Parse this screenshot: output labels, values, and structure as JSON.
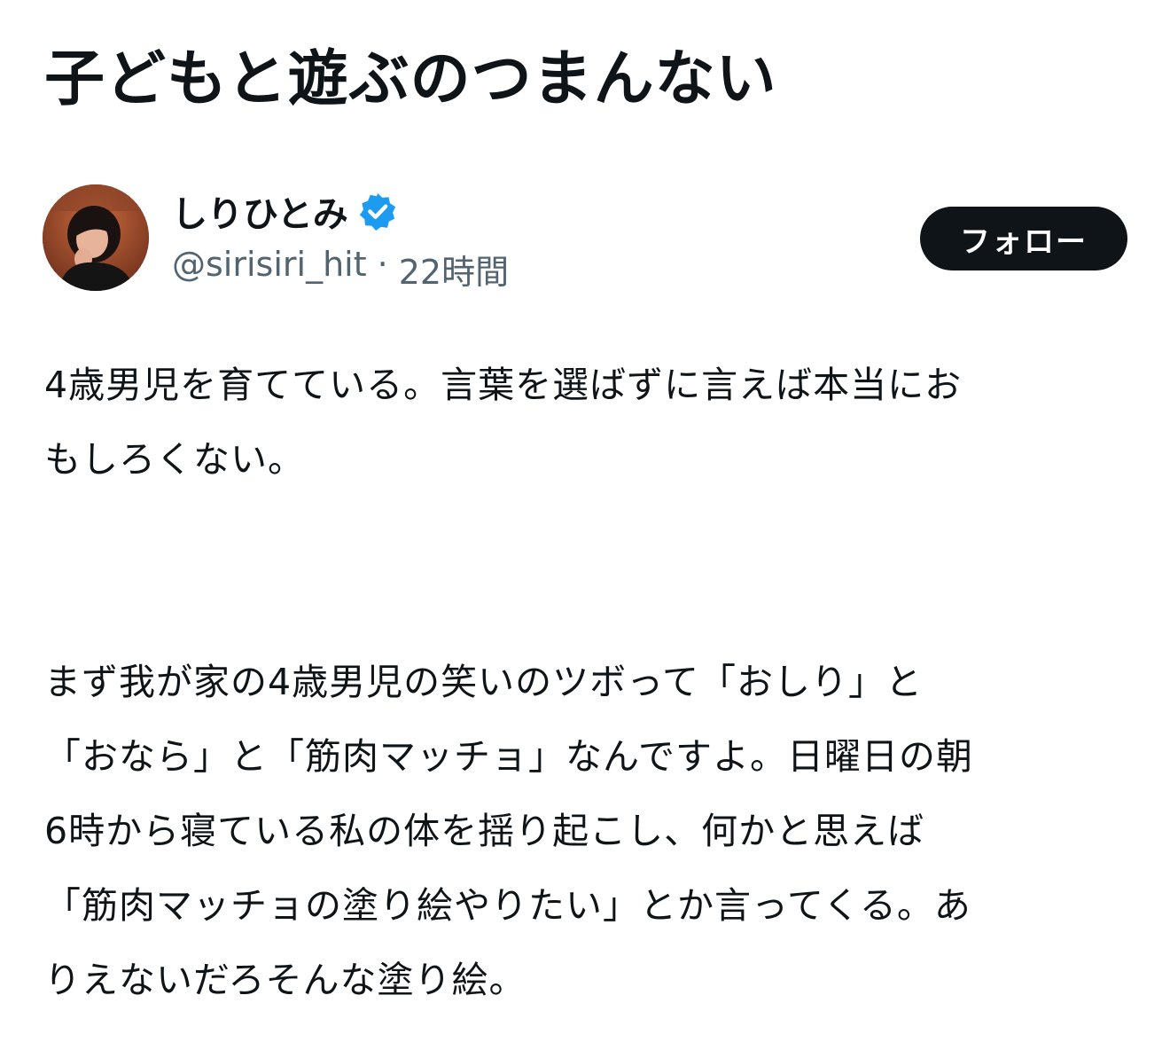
{
  "article": {
    "title": "子どもと遊ぶのつまんない"
  },
  "author": {
    "display_name": "しりひとみ",
    "handle": "@sirisiri_hit",
    "separator": "·",
    "time": "22時間",
    "verified": true,
    "avatar_icon": "user-avatar-photo",
    "verified_color": "#1d9bf0"
  },
  "follow_button": {
    "label": "フォロー"
  },
  "body": {
    "paragraph1": [
      "4歳男児を育てている。言葉を選ばずに言えば本当にお",
      "もしろくない。"
    ],
    "paragraph2": [
      "まず我が家の4歳男児の笑いのツボって「おしり」と",
      "「おなら」と「筋肉マッチョ」なんですよ。日曜日の朝",
      "6時から寝ている私の体を揺り起こし、何かと思えば",
      "「筋肉マッチョの塗り絵やりたい」とか言ってくる。あ",
      "りえないだろそんな塗り絵。"
    ]
  },
  "colors": {
    "text": "#0f1419",
    "secondary_text": "#536471",
    "button_bg": "#0f1419",
    "button_text": "#ffffff"
  }
}
